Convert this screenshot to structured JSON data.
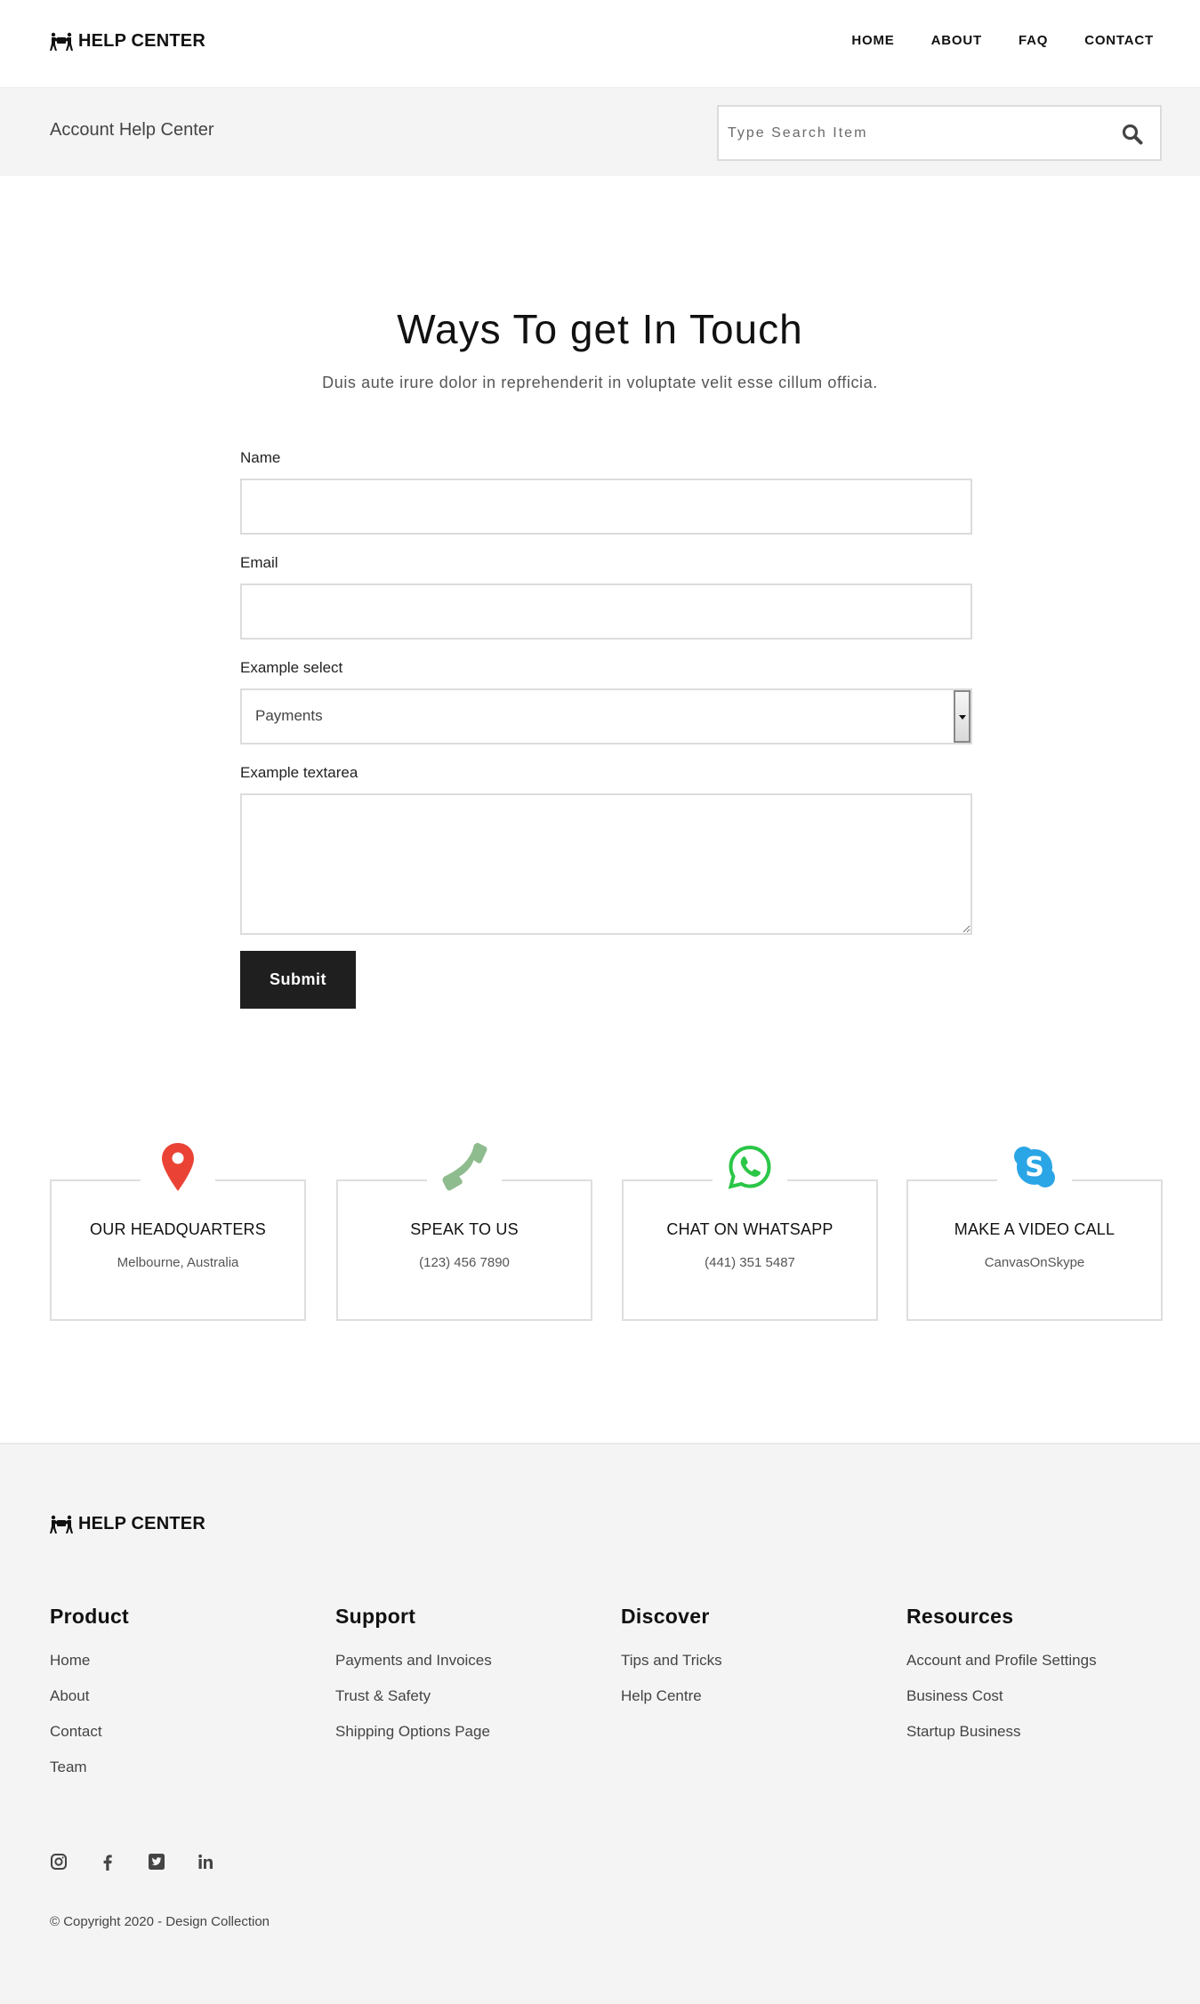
{
  "header": {
    "logo_text": "HELP CENTER",
    "logo_icon": "people-carry-icon",
    "nav": [
      {
        "label": "HOME"
      },
      {
        "label": "ABOUT"
      },
      {
        "label": "FAQ"
      },
      {
        "label": "CONTACT"
      }
    ]
  },
  "subband": {
    "title": "Account Help Center",
    "search": {
      "placeholder": "Type Search Item",
      "value": "",
      "icon": "search-icon"
    }
  },
  "hero": {
    "title": "Ways To get In Touch",
    "subtitle": "Duis aute irure dolor in reprehenderit in voluptate velit esse cillum officia."
  },
  "form": {
    "name": {
      "label": "Name",
      "value": ""
    },
    "email": {
      "label": "Email",
      "value": ""
    },
    "select": {
      "label": "Example select",
      "value": "Payments"
    },
    "textarea": {
      "label": "Example textarea",
      "value": ""
    },
    "submit_label": "Submit"
  },
  "contact_cards": [
    {
      "icon": "map-pin-icon",
      "color": "#EA4335",
      "title": "OUR HEADQUARTERS",
      "text": "Melbourne, Australia"
    },
    {
      "icon": "phone-icon",
      "color": "#8FBC8F",
      "title": "SPEAK TO US",
      "text": "(123) 456 7890"
    },
    {
      "icon": "whatsapp-icon",
      "color": "#2BC647",
      "title": "CHAT ON WHATSAPP",
      "text": "(441) 351 5487"
    },
    {
      "icon": "skype-icon",
      "color": "#2AA5E6",
      "title": "MAKE A VIDEO CALL",
      "text": "CanvasOnSkype"
    }
  ],
  "footer": {
    "logo_text": "HELP CENTER",
    "columns": [
      {
        "heading": "Product",
        "links": [
          "Home",
          "About",
          "Contact",
          "Team"
        ]
      },
      {
        "heading": "Support",
        "links": [
          "Payments and Invoices",
          "Trust & Safety",
          "Shipping Options Page"
        ]
      },
      {
        "heading": "Discover",
        "links": [
          "Tips and Tricks",
          "Help Centre"
        ]
      },
      {
        "heading": "Resources",
        "links": [
          "Account and Profile Settings",
          "Business Cost",
          "Startup Business"
        ]
      }
    ],
    "social": [
      "instagram-icon",
      "facebook-icon",
      "twitter-icon",
      "linkedin-icon"
    ],
    "copyright": "© Copyright 2020 - Design Collection"
  }
}
